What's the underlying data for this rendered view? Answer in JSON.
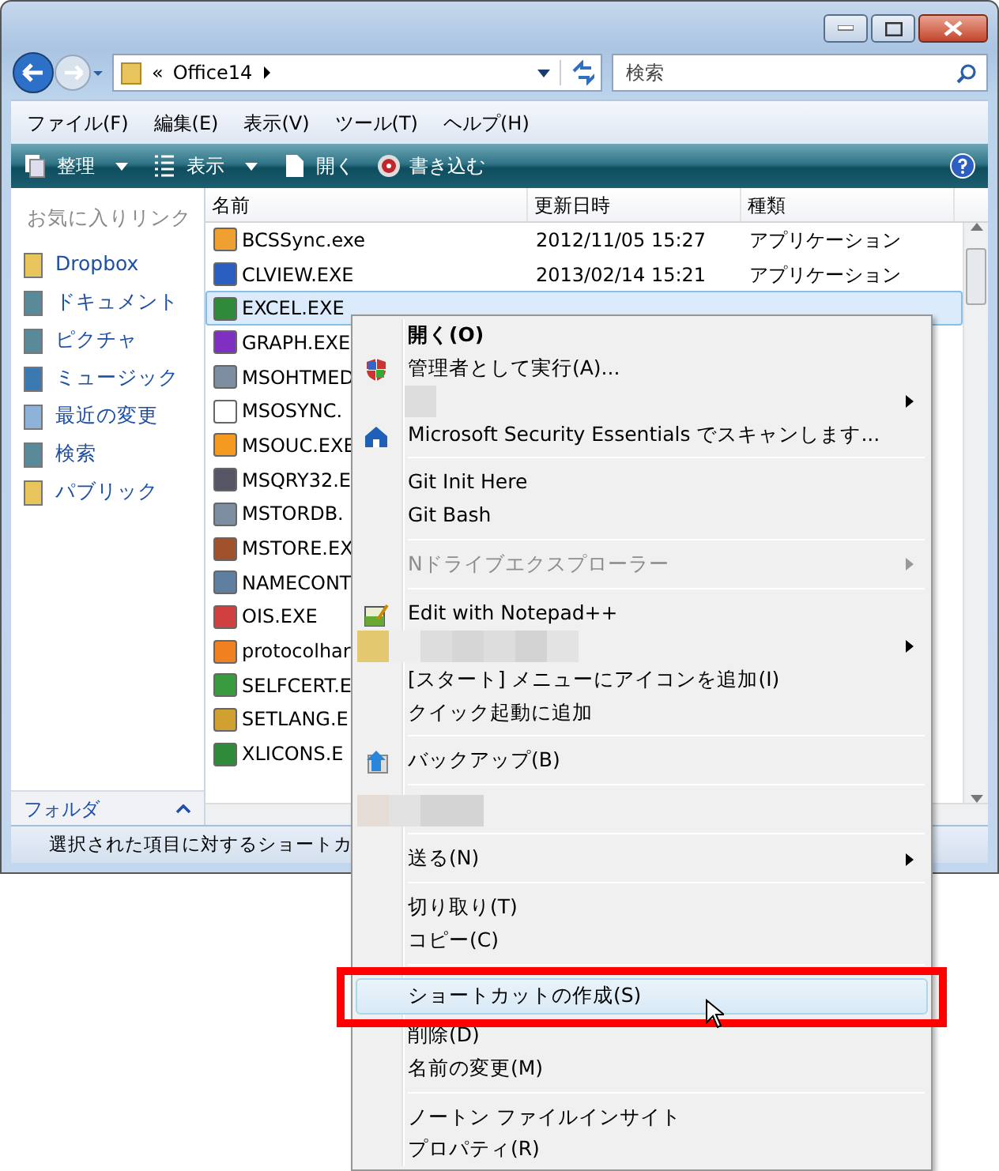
{
  "address_bar": {
    "overflow": "«",
    "folder": "Office14"
  },
  "search": {
    "placeholder": "検索"
  },
  "menu_bar": [
    "ファイル(F)",
    "編集(E)",
    "表示(V)",
    "ツール(T)",
    "ヘルプ(H)"
  ],
  "toolbar": [
    {
      "label": "整理",
      "dropdown": true
    },
    {
      "label": "表示",
      "dropdown": true
    },
    {
      "label": "開く",
      "dropdown": false
    },
    {
      "label": "書き込む",
      "dropdown": false
    }
  ],
  "sidebar": {
    "title": "お気に入りリンク",
    "items": [
      "Dropbox",
      "ドキュメント",
      "ピクチャ",
      "ミュージック",
      "最近の変更",
      "検索",
      "パブリック"
    ],
    "footer": "フォルダ"
  },
  "table": {
    "columns": [
      "名前",
      "更新日時",
      "種類"
    ],
    "rows": [
      {
        "name": "BCSSync.exe",
        "modified": "2012/11/05 15:27",
        "type": "アプリケーション",
        "selected": false
      },
      {
        "name": "CLVIEW.EXE",
        "modified": "2013/02/14 15:21",
        "type": "アプリケーション",
        "selected": false
      },
      {
        "name": "EXCEL.EXE",
        "selected": true
      },
      {
        "name": "GRAPH.EXE",
        "selected": false
      },
      {
        "name": "MSOHTMED",
        "selected": false
      },
      {
        "name": "MSOSYNC.",
        "selected": false
      },
      {
        "name": "MSOUC.EXE",
        "selected": false
      },
      {
        "name": "MSQRY32.E",
        "selected": false
      },
      {
        "name": "MSTORDB.",
        "selected": false
      },
      {
        "name": "MSTORE.EX",
        "selected": false
      },
      {
        "name": "NAMECONT",
        "selected": false
      },
      {
        "name": "OIS.EXE",
        "selected": false
      },
      {
        "name": "protocolhar",
        "selected": false
      },
      {
        "name": "SELFCERT.E",
        "selected": false
      },
      {
        "name": "SETLANG.E",
        "selected": false
      },
      {
        "name": "XLICONS.E",
        "selected": false
      }
    ]
  },
  "status_bar": "選択された項目に対するショートカ",
  "context_menu": {
    "items": [
      {
        "kind": "item",
        "label": "開く(O)",
        "bold": true,
        "disabled": false,
        "submenu": false,
        "selected": false
      },
      {
        "kind": "item",
        "label": "管理者として実行(A)...",
        "bold": false,
        "disabled": false,
        "submenu": false,
        "selected": false
      },
      {
        "kind": "redacted",
        "submenu": true
      },
      {
        "kind": "item",
        "label": "Microsoft Security Essentials でスキャンします...",
        "bold": false,
        "disabled": false,
        "submenu": false,
        "selected": false
      },
      {
        "kind": "separator"
      },
      {
        "kind": "item",
        "label": "Git Init Here",
        "bold": false,
        "disabled": false,
        "submenu": false,
        "selected": false
      },
      {
        "kind": "item",
        "label": "Git Bash",
        "bold": false,
        "disabled": false,
        "submenu": false,
        "selected": false
      },
      {
        "kind": "separator"
      },
      {
        "kind": "item",
        "label": "Nドライブエクスプローラー",
        "bold": false,
        "disabled": true,
        "submenu": true,
        "selected": false
      },
      {
        "kind": "separator"
      },
      {
        "kind": "item",
        "label": "Edit with Notepad++",
        "bold": false,
        "disabled": false,
        "submenu": false,
        "selected": false
      },
      {
        "kind": "redacted",
        "submenu": true
      },
      {
        "kind": "item",
        "label": "[スタート] メニューにアイコンを追加(I)",
        "bold": false,
        "disabled": false,
        "submenu": false,
        "selected": false
      },
      {
        "kind": "item",
        "label": "クイック起動に追加",
        "bold": false,
        "disabled": false,
        "submenu": false,
        "selected": false
      },
      {
        "kind": "separator"
      },
      {
        "kind": "item",
        "label": "バックアップ(B)",
        "bold": false,
        "disabled": false,
        "submenu": false,
        "selected": false
      },
      {
        "kind": "separator"
      },
      {
        "kind": "redacted",
        "submenu": false
      },
      {
        "kind": "separator"
      },
      {
        "kind": "item",
        "label": "送る(N)",
        "bold": false,
        "disabled": false,
        "submenu": true,
        "selected": false
      },
      {
        "kind": "separator"
      },
      {
        "kind": "item",
        "label": "切り取り(T)",
        "bold": false,
        "disabled": false,
        "submenu": false,
        "selected": false
      },
      {
        "kind": "item",
        "label": "コピー(C)",
        "bold": false,
        "disabled": false,
        "submenu": false,
        "selected": false
      },
      {
        "kind": "separator"
      },
      {
        "kind": "item",
        "label": "ショートカットの作成(S)",
        "bold": false,
        "disabled": false,
        "submenu": false,
        "selected": true
      },
      {
        "kind": "item",
        "label": "削除(D)",
        "bold": false,
        "disabled": false,
        "submenu": false,
        "selected": false
      },
      {
        "kind": "item",
        "label": "名前の変更(M)",
        "bold": false,
        "disabled": false,
        "submenu": false,
        "selected": false
      },
      {
        "kind": "separator"
      },
      {
        "kind": "item",
        "label": "ノートン ファイルインサイト",
        "bold": false,
        "disabled": false,
        "submenu": false,
        "selected": false
      },
      {
        "kind": "item",
        "label": "プロパティ(R)",
        "bold": false,
        "disabled": false,
        "submenu": false,
        "selected": false
      }
    ]
  }
}
